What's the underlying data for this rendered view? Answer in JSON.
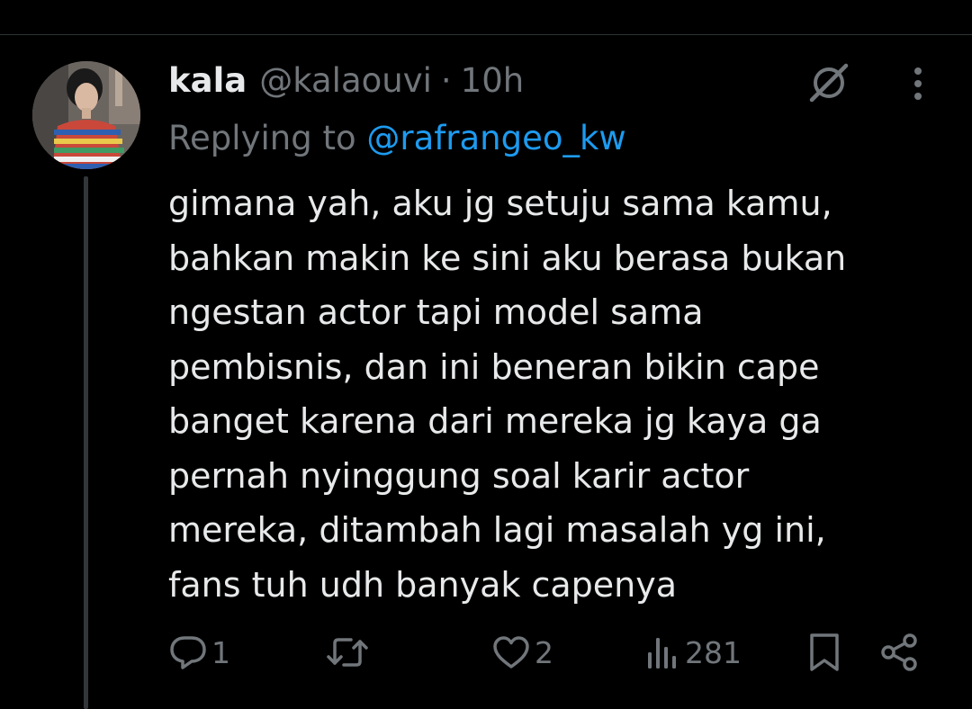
{
  "tweet": {
    "display_name": "kala",
    "handle": "@kalaouvi",
    "separator": "·",
    "time_ago": "10h",
    "replying_to_prefix": "Replying to",
    "replying_to_handle": "@rafrangeo_kw",
    "text": "gimana yah, aku jg setuju sama kamu,\nbahkan makin ke sini aku berasa bukan\nngestan actor tapi model sama\npembisnis, dan ini beneran bikin cape\nbanget karena dari mereka jg kaya ga\npernah nyinggung soal karir actor\nmereka, ditambah lagi masalah yg ini,\nfans tuh udh banyak capenya"
  },
  "actions": {
    "reply_count": "1",
    "retweet_count": "",
    "like_count": "2",
    "view_count": "281"
  },
  "icons": {
    "header": [
      "grok-icon",
      "more-vertical-icon"
    ],
    "actions": [
      "reply-icon",
      "retweet-icon",
      "like-icon",
      "views-icon",
      "bookmark-icon",
      "share-icon"
    ]
  },
  "colors": {
    "background": "#000000",
    "primary_text": "#e7e9ea",
    "secondary_text": "#71767b",
    "link": "#1d9bf0",
    "divider": "#2f3336"
  }
}
